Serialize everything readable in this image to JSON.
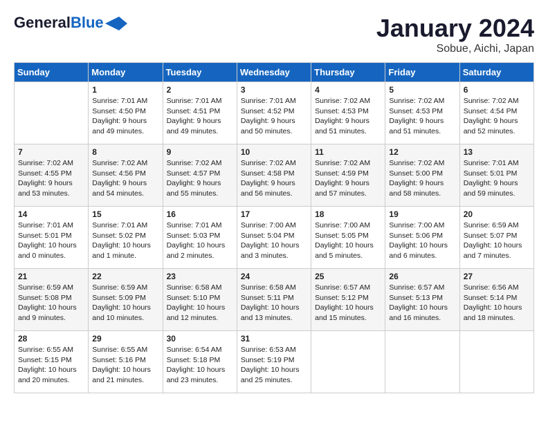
{
  "header": {
    "logo_line1": "General",
    "logo_line2": "Blue",
    "month": "January 2024",
    "location": "Sobue, Aichi, Japan"
  },
  "days_of_week": [
    "Sunday",
    "Monday",
    "Tuesday",
    "Wednesday",
    "Thursday",
    "Friday",
    "Saturday"
  ],
  "weeks": [
    [
      {
        "day": "",
        "info": ""
      },
      {
        "day": "1",
        "info": "Sunrise: 7:01 AM\nSunset: 4:50 PM\nDaylight: 9 hours\nand 49 minutes."
      },
      {
        "day": "2",
        "info": "Sunrise: 7:01 AM\nSunset: 4:51 PM\nDaylight: 9 hours\nand 49 minutes."
      },
      {
        "day": "3",
        "info": "Sunrise: 7:01 AM\nSunset: 4:52 PM\nDaylight: 9 hours\nand 50 minutes."
      },
      {
        "day": "4",
        "info": "Sunrise: 7:02 AM\nSunset: 4:53 PM\nDaylight: 9 hours\nand 51 minutes."
      },
      {
        "day": "5",
        "info": "Sunrise: 7:02 AM\nSunset: 4:53 PM\nDaylight: 9 hours\nand 51 minutes."
      },
      {
        "day": "6",
        "info": "Sunrise: 7:02 AM\nSunset: 4:54 PM\nDaylight: 9 hours\nand 52 minutes."
      }
    ],
    [
      {
        "day": "7",
        "info": "Sunrise: 7:02 AM\nSunset: 4:55 PM\nDaylight: 9 hours\nand 53 minutes."
      },
      {
        "day": "8",
        "info": "Sunrise: 7:02 AM\nSunset: 4:56 PM\nDaylight: 9 hours\nand 54 minutes."
      },
      {
        "day": "9",
        "info": "Sunrise: 7:02 AM\nSunset: 4:57 PM\nDaylight: 9 hours\nand 55 minutes."
      },
      {
        "day": "10",
        "info": "Sunrise: 7:02 AM\nSunset: 4:58 PM\nDaylight: 9 hours\nand 56 minutes."
      },
      {
        "day": "11",
        "info": "Sunrise: 7:02 AM\nSunset: 4:59 PM\nDaylight: 9 hours\nand 57 minutes."
      },
      {
        "day": "12",
        "info": "Sunrise: 7:02 AM\nSunset: 5:00 PM\nDaylight: 9 hours\nand 58 minutes."
      },
      {
        "day": "13",
        "info": "Sunrise: 7:01 AM\nSunset: 5:01 PM\nDaylight: 9 hours\nand 59 minutes."
      }
    ],
    [
      {
        "day": "14",
        "info": "Sunrise: 7:01 AM\nSunset: 5:01 PM\nDaylight: 10 hours\nand 0 minutes."
      },
      {
        "day": "15",
        "info": "Sunrise: 7:01 AM\nSunset: 5:02 PM\nDaylight: 10 hours\nand 1 minute."
      },
      {
        "day": "16",
        "info": "Sunrise: 7:01 AM\nSunset: 5:03 PM\nDaylight: 10 hours\nand 2 minutes."
      },
      {
        "day": "17",
        "info": "Sunrise: 7:00 AM\nSunset: 5:04 PM\nDaylight: 10 hours\nand 3 minutes."
      },
      {
        "day": "18",
        "info": "Sunrise: 7:00 AM\nSunset: 5:05 PM\nDaylight: 10 hours\nand 5 minutes."
      },
      {
        "day": "19",
        "info": "Sunrise: 7:00 AM\nSunset: 5:06 PM\nDaylight: 10 hours\nand 6 minutes."
      },
      {
        "day": "20",
        "info": "Sunrise: 6:59 AM\nSunset: 5:07 PM\nDaylight: 10 hours\nand 7 minutes."
      }
    ],
    [
      {
        "day": "21",
        "info": "Sunrise: 6:59 AM\nSunset: 5:08 PM\nDaylight: 10 hours\nand 9 minutes."
      },
      {
        "day": "22",
        "info": "Sunrise: 6:59 AM\nSunset: 5:09 PM\nDaylight: 10 hours\nand 10 minutes."
      },
      {
        "day": "23",
        "info": "Sunrise: 6:58 AM\nSunset: 5:10 PM\nDaylight: 10 hours\nand 12 minutes."
      },
      {
        "day": "24",
        "info": "Sunrise: 6:58 AM\nSunset: 5:11 PM\nDaylight: 10 hours\nand 13 minutes."
      },
      {
        "day": "25",
        "info": "Sunrise: 6:57 AM\nSunset: 5:12 PM\nDaylight: 10 hours\nand 15 minutes."
      },
      {
        "day": "26",
        "info": "Sunrise: 6:57 AM\nSunset: 5:13 PM\nDaylight: 10 hours\nand 16 minutes."
      },
      {
        "day": "27",
        "info": "Sunrise: 6:56 AM\nSunset: 5:14 PM\nDaylight: 10 hours\nand 18 minutes."
      }
    ],
    [
      {
        "day": "28",
        "info": "Sunrise: 6:55 AM\nSunset: 5:15 PM\nDaylight: 10 hours\nand 20 minutes."
      },
      {
        "day": "29",
        "info": "Sunrise: 6:55 AM\nSunset: 5:16 PM\nDaylight: 10 hours\nand 21 minutes."
      },
      {
        "day": "30",
        "info": "Sunrise: 6:54 AM\nSunset: 5:18 PM\nDaylight: 10 hours\nand 23 minutes."
      },
      {
        "day": "31",
        "info": "Sunrise: 6:53 AM\nSunset: 5:19 PM\nDaylight: 10 hours\nand 25 minutes."
      },
      {
        "day": "",
        "info": ""
      },
      {
        "day": "",
        "info": ""
      },
      {
        "day": "",
        "info": ""
      }
    ]
  ]
}
